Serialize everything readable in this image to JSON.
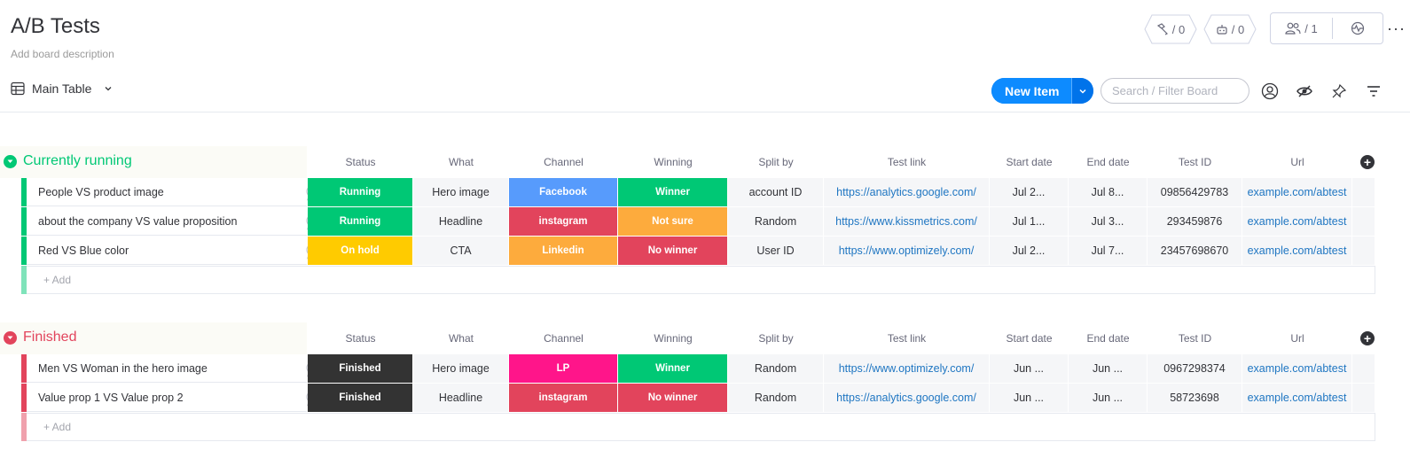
{
  "header": {
    "title": "A/B Tests",
    "description": "Add board description",
    "view_label": "Main Table",
    "integrations_count": "/ 0",
    "automations_count": "/ 0",
    "members_count": "/ 1",
    "new_item_label": "New Item",
    "search_placeholder": "Search / Filter Board",
    "more_label": "···"
  },
  "colors": {
    "running": "#00c875",
    "onhold": "#ffcb00",
    "finished": "#333333",
    "facebook": "#579bfc",
    "instagram": "#e2445c",
    "linkedin": "#fdab3d",
    "lp": "#ff158a",
    "winner": "#00c875",
    "notsure": "#fdab3d",
    "nowinner": "#e2445c",
    "group_running": "#00c875",
    "group_finished": "#e2445c"
  },
  "columns": [
    "Status",
    "What",
    "Channel",
    "Winning",
    "Split by",
    "Test link",
    "Start date",
    "End date",
    "Test ID",
    "Url"
  ],
  "add_row_label": "+ Add",
  "groups": [
    {
      "title": "Currently running",
      "color": "#00c875",
      "rows": [
        {
          "name": "People VS product image",
          "status": "Running",
          "status_color": "#00c875",
          "what": "Hero image",
          "channel": "Facebook",
          "channel_color": "#579bfc",
          "winning": "Winner",
          "winning_color": "#00c875",
          "split": "account ID",
          "link": "https://analytics.google.com/",
          "start": "Jul 2...",
          "end": "Jul 8...",
          "test_id": "09856429783",
          "url": "example.com/abtest"
        },
        {
          "name": "about the company VS value proposition",
          "status": "Running",
          "status_color": "#00c875",
          "what": "Headline",
          "channel": "instagram",
          "channel_color": "#e2445c",
          "winning": "Not sure",
          "winning_color": "#fdab3d",
          "split": "Random",
          "link": "https://www.kissmetrics.com/",
          "start": "Jul 1...",
          "end": "Jul 3...",
          "test_id": "293459876",
          "url": "example.com/abtest"
        },
        {
          "name": "Red VS Blue color",
          "status": "On hold",
          "status_color": "#ffcb00",
          "what": "CTA",
          "channel": "Linkedin",
          "channel_color": "#fdab3d",
          "winning": "No winner",
          "winning_color": "#e2445c",
          "split": "User ID",
          "link": "https://www.optimizely.com/",
          "start": "Jul 2...",
          "end": "Jul 7...",
          "test_id": "23457698670",
          "url": "example.com/abtest"
        }
      ]
    },
    {
      "title": "Finished",
      "color": "#e2445c",
      "rows": [
        {
          "name": "Men VS Woman in the hero image",
          "status": "Finished",
          "status_color": "#333333",
          "what": "Hero image",
          "channel": "LP",
          "channel_color": "#ff158a",
          "winning": "Winner",
          "winning_color": "#00c875",
          "split": "Random",
          "link": "https://www.optimizely.com/",
          "start": "Jun ...",
          "end": "Jun ...",
          "test_id": "0967298374",
          "url": "example.com/abtest"
        },
        {
          "name": "Value prop 1 VS Value prop 2",
          "status": "Finished",
          "status_color": "#333333",
          "what": "Headline",
          "channel": "instagram",
          "channel_color": "#e2445c",
          "winning": "No winner",
          "winning_color": "#e2445c",
          "split": "Random",
          "link": "https://analytics.google.com/",
          "start": "Jun ...",
          "end": "Jun ...",
          "test_id": "58723698",
          "url": "example.com/abtest"
        }
      ]
    }
  ]
}
